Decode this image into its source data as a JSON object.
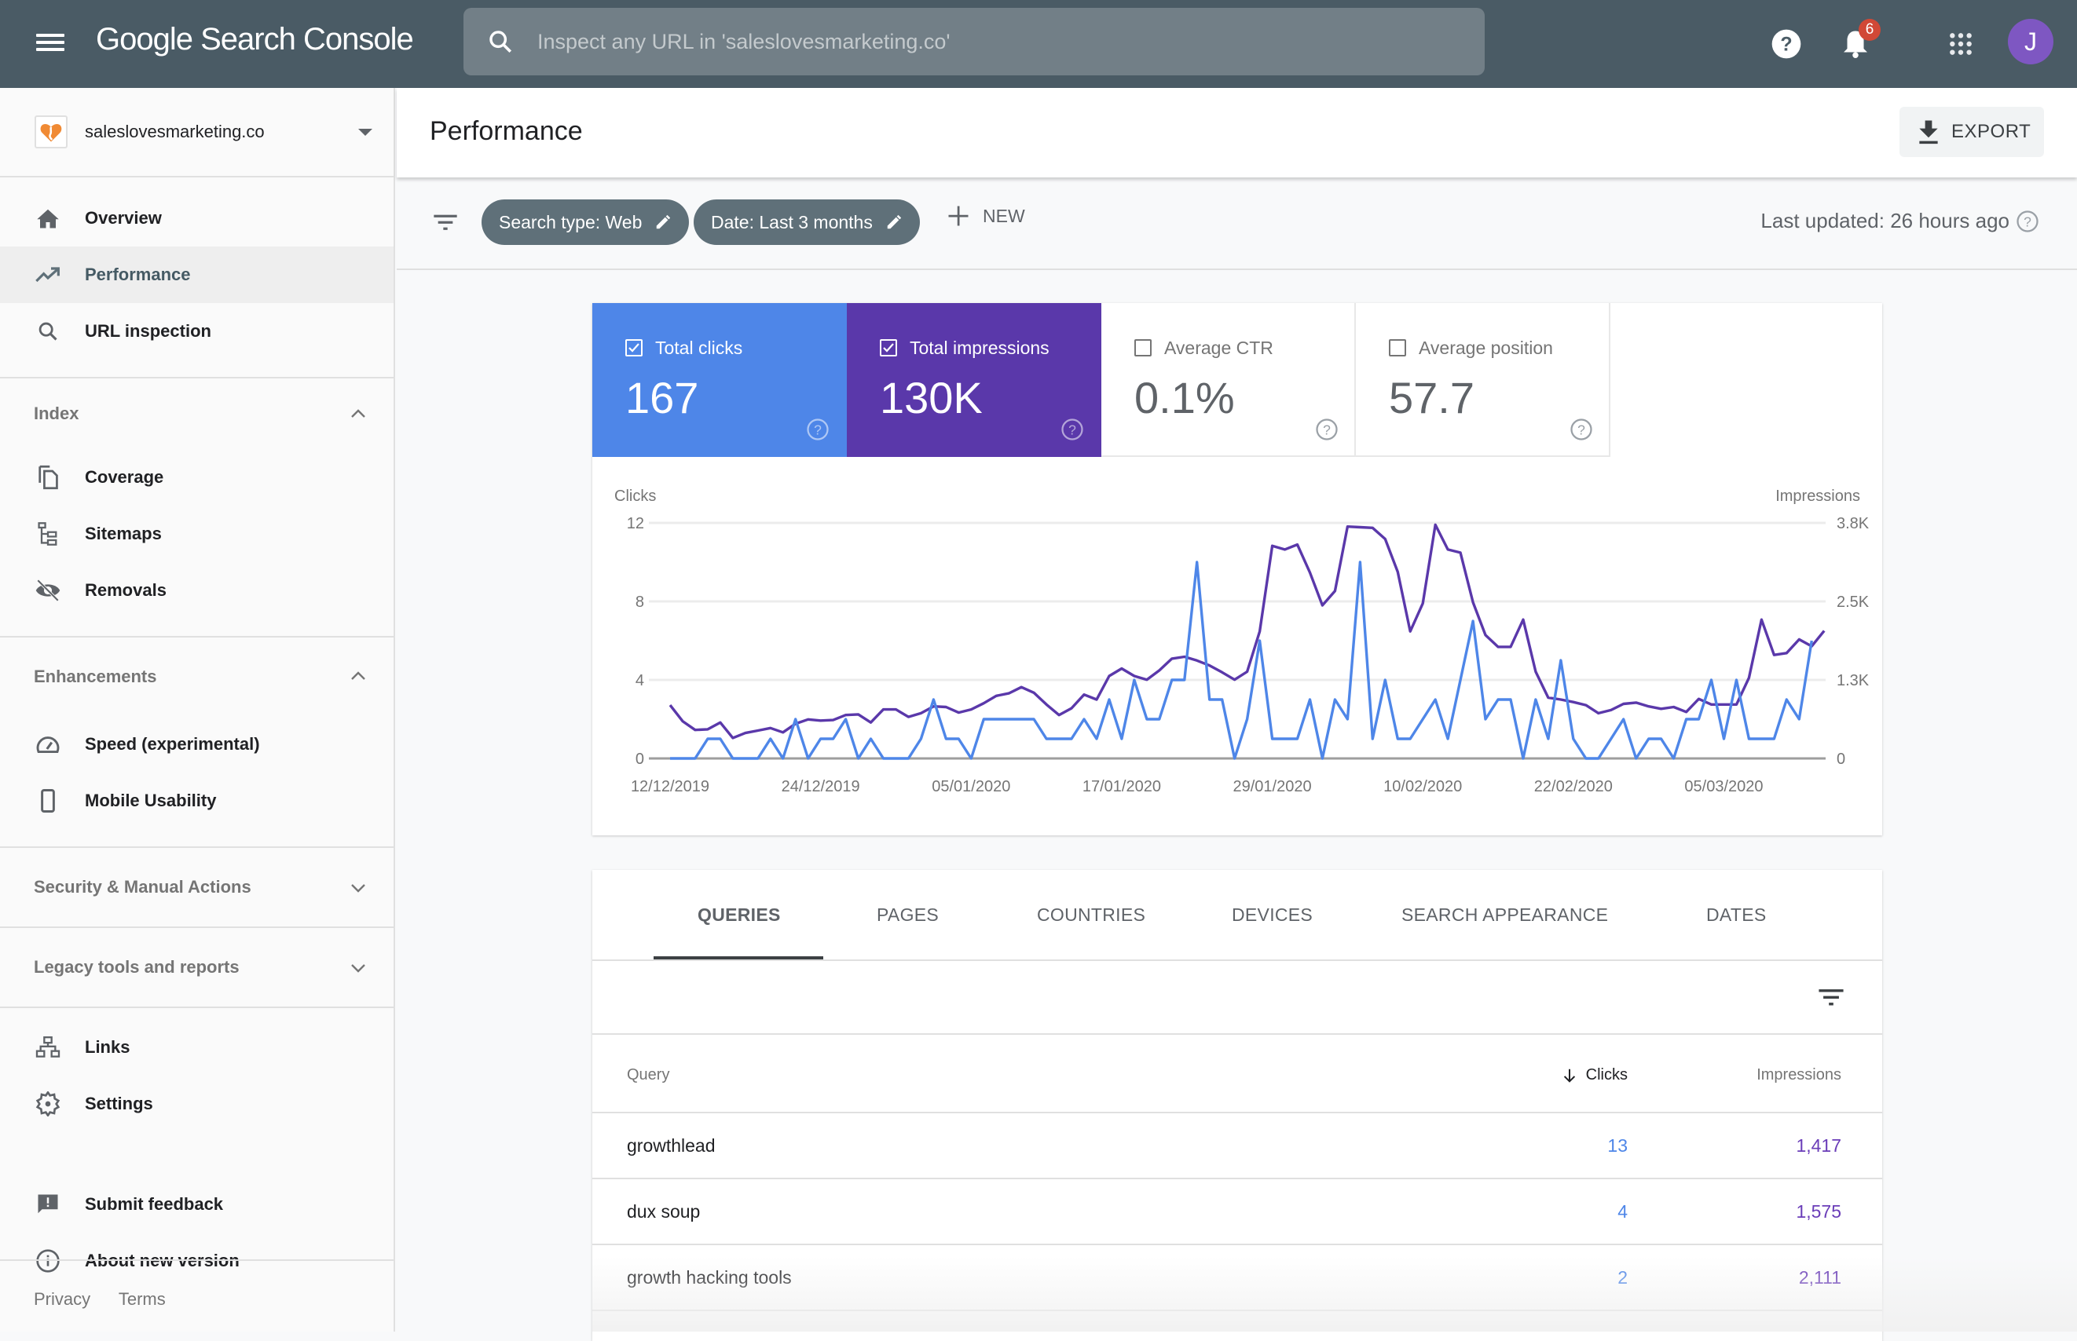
{
  "app": {
    "title": "Google Search Console",
    "search_placeholder": "Inspect any URL in 'saleslovesmarketing.co'",
    "notifications_count": "6",
    "avatar_initial": "J"
  },
  "sidebar": {
    "property": "saleslovesmarketing.co",
    "top_items": [
      {
        "label": "Overview",
        "icon": "home-icon",
        "active": false
      },
      {
        "label": "Performance",
        "icon": "trending-up-icon",
        "active": true
      },
      {
        "label": "URL inspection",
        "icon": "search-icon",
        "active": false
      }
    ],
    "sections": {
      "index": {
        "label": "Index",
        "expanded": true,
        "items": [
          {
            "label": "Coverage",
            "icon": "coverage-icon"
          },
          {
            "label": "Sitemaps",
            "icon": "sitemap-icon"
          },
          {
            "label": "Removals",
            "icon": "eye-off-icon"
          }
        ]
      },
      "enhancements": {
        "label": "Enhancements",
        "expanded": true,
        "items": [
          {
            "label": "Speed (experimental)",
            "icon": "speedometer-icon"
          },
          {
            "label": "Mobile Usability",
            "icon": "phone-icon"
          }
        ]
      },
      "security": {
        "label": "Security & Manual Actions",
        "expanded": false
      },
      "legacy": {
        "label": "Legacy tools and reports",
        "expanded": false
      }
    },
    "bottom_items": [
      {
        "label": "Links",
        "icon": "links-icon"
      },
      {
        "label": "Settings",
        "icon": "gear-icon"
      }
    ],
    "footer_items": [
      {
        "label": "Submit feedback",
        "icon": "feedback-icon"
      },
      {
        "label": "About new version",
        "icon": "info-icon"
      }
    ],
    "legal": {
      "privacy": "Privacy",
      "terms": "Terms"
    }
  },
  "header": {
    "title": "Performance",
    "export_label": "EXPORT"
  },
  "filters": {
    "chips": [
      "Search type: Web",
      "Date: Last 3 months"
    ],
    "new_label": "NEW",
    "last_updated": "Last updated: 26 hours ago"
  },
  "metrics": [
    {
      "label": "Total clicks",
      "value": "167",
      "checked": true,
      "color": "#4e86e8"
    },
    {
      "label": "Total impressions",
      "value": "130K",
      "checked": true,
      "color": "#5a38aa"
    },
    {
      "label": "Average CTR",
      "value": "0.1%",
      "checked": false
    },
    {
      "label": "Average position",
      "value": "57.7",
      "checked": false
    }
  ],
  "chart_data": {
    "type": "line",
    "left_axis_label": "Clicks",
    "right_axis_label": "Impressions",
    "left_ticks": [
      "0",
      "4",
      "8",
      "12"
    ],
    "right_ticks": [
      "0",
      "1.3K",
      "2.5K",
      "3.8K"
    ],
    "ylim_left": [
      0,
      12
    ],
    "ylim_right": [
      0,
      3800
    ],
    "x_tick_labels": [
      "12/12/2019",
      "24/12/2019",
      "05/01/2020",
      "17/01/2020",
      "29/01/2020",
      "10/02/2020",
      "22/02/2020",
      "05/03/2020"
    ],
    "x_start": "12/12/2019",
    "x_end": "10/03/2020",
    "grid": true,
    "series": [
      {
        "name": "Clicks",
        "axis": "left",
        "color": "#4e86e8",
        "values": [
          0,
          0,
          0,
          1,
          1,
          0,
          0,
          0,
          1,
          0,
          2,
          0,
          1,
          1,
          2,
          0,
          1,
          0,
          0,
          0,
          1,
          3,
          1,
          1,
          0,
          2,
          2,
          2,
          2,
          2,
          1,
          1,
          1,
          2,
          1,
          3,
          1,
          4,
          2,
          2,
          4,
          4,
          10,
          3,
          3,
          0,
          2,
          6,
          1,
          1,
          1,
          3,
          0,
          3,
          2,
          10,
          1,
          4,
          1,
          1,
          2,
          3,
          1,
          4,
          7,
          2,
          3,
          3,
          0,
          3,
          1,
          5,
          1,
          0,
          0,
          1,
          2,
          0,
          1,
          1,
          0,
          2,
          2,
          4,
          1,
          4,
          1,
          1,
          1,
          3,
          2,
          6
        ]
      },
      {
        "name": "Impressions",
        "axis": "right",
        "color": "#5a38aa",
        "values": [
          860,
          600,
          460,
          470,
          580,
          330,
          410,
          450,
          490,
          420,
          560,
          630,
          610,
          620,
          700,
          710,
          580,
          790,
          790,
          670,
          730,
          840,
          830,
          740,
          790,
          890,
          1010,
          1050,
          1150,
          1060,
          870,
          700,
          810,
          1030,
          950,
          1330,
          1450,
          1330,
          1270,
          1420,
          1610,
          1640,
          1580,
          1500,
          1390,
          1270,
          1400,
          2050,
          3430,
          3370,
          3450,
          3000,
          2470,
          2700,
          3740,
          3730,
          3720,
          3540,
          3010,
          2050,
          2500,
          3770,
          3370,
          3320,
          2520,
          1990,
          1800,
          1800,
          2240,
          1400,
          980,
          950,
          910,
          860,
          730,
          780,
          880,
          900,
          840,
          800,
          830,
          750,
          960,
          870,
          870,
          870,
          1300,
          2240,
          1670,
          1700,
          1920,
          1810,
          2060
        ]
      }
    ]
  },
  "table": {
    "tabs": [
      "QUERIES",
      "PAGES",
      "COUNTRIES",
      "DEVICES",
      "SEARCH APPEARANCE",
      "DATES"
    ],
    "active_tab": "QUERIES",
    "columns": {
      "query": "Query",
      "clicks": "Clicks",
      "impressions": "Impressions"
    },
    "rows": [
      {
        "query": "growthlead",
        "clicks": "13",
        "impressions": "1,417"
      },
      {
        "query": "dux soup",
        "clicks": "4",
        "impressions": "1,575"
      },
      {
        "query": "growth hacking tools",
        "clicks": "2",
        "impressions": "2,111"
      }
    ]
  }
}
